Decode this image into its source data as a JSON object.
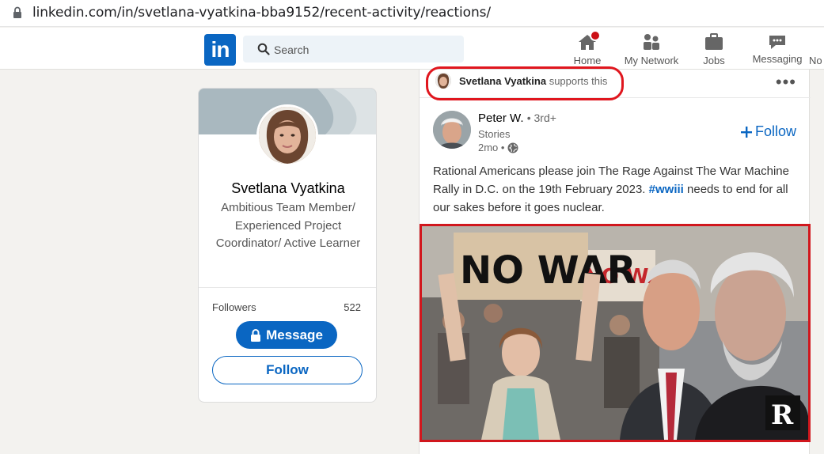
{
  "browser": {
    "url": "linkedin.com/in/svetlana-vyatkina-bba9152/recent-activity/reactions/"
  },
  "nav": {
    "logo_text": "in",
    "search_placeholder": "Search",
    "items": [
      {
        "label": "Home",
        "icon": "home-icon"
      },
      {
        "label": "My Network",
        "icon": "network-icon"
      },
      {
        "label": "Jobs",
        "icon": "briefcase-icon"
      },
      {
        "label": "Messaging",
        "icon": "messaging-icon"
      },
      {
        "label": "No",
        "icon": "notifications-icon"
      }
    ]
  },
  "profile": {
    "name": "Svetlana Vyatkina",
    "tagline": "Ambitious Team Member/ Experienced Project Coordinator/ Active Learner",
    "followers_label": "Followers",
    "followers_count": "522",
    "message_label": "Message",
    "follow_label": "Follow"
  },
  "post": {
    "reactor_name": "Svetlana Vyatkina",
    "reaction_text": "supports this",
    "more_label": "•••",
    "author_name": "Peter W.",
    "author_degree": "• 3rd+",
    "author_subtitle": "Stories",
    "author_time": "2mo •",
    "follow_label": "Follow",
    "text_before": "Rational Americans please join The Rage Against The War Machine Rally in D.C. on the 19th February 2023. ",
    "hashtag": "#wwiii",
    "text_after": " needs to end for all our sakes before it goes nuclear.",
    "image": {
      "sign_text": "NO WAR",
      "background_sign_text": "NO WA",
      "watermark": "R"
    }
  },
  "colors": {
    "linkedin_blue": "#0a66c2",
    "highlight_red": "#e0161e",
    "notification_red": "#cc1016"
  }
}
